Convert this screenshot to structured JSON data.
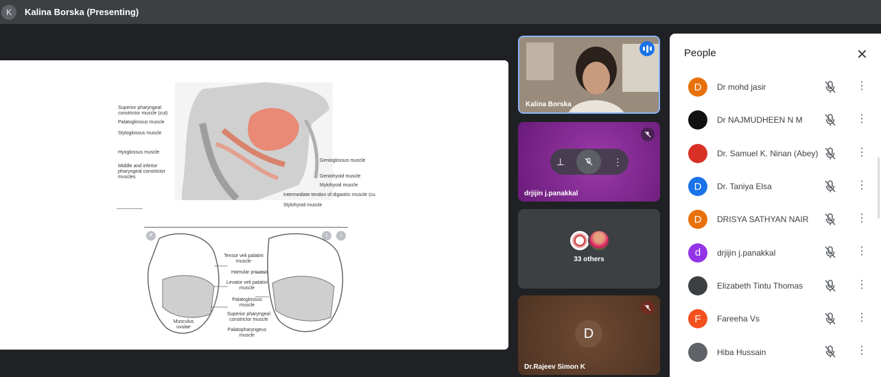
{
  "header": {
    "avatar_letter": "K",
    "title": "Kalina Borska (Presenting)"
  },
  "slide": {
    "top_labels_left": [
      "Superior pharyngeal constrictor muscle (cut)",
      "Palatoglossus muscle",
      "Styloglossus muscle",
      "Hyoglossus muscle",
      "Middle and inferior pharyngeal constrictor muscles"
    ],
    "top_labels_right": [
      "Genioglossus muscle",
      "Geniohyoid muscle",
      "Mylohyoid muscle",
      "Intermediate tendon of digastric muscle (cu",
      "Stylohyoid muscle"
    ],
    "bottom_labels": [
      "Tensor veli palatini muscle",
      "Hamular process",
      "Levator veli palatini muscle",
      "Palatoglossus muscle",
      "Superior pharyngeal constrictor muscle",
      "Palatopharyngeus muscle"
    ],
    "bottom_left_label": "Musculus uvulae"
  },
  "tiles": [
    {
      "name": "Kalina Borska",
      "state": "speaking"
    },
    {
      "name": "drjijin j.panakkal",
      "state": "muted"
    },
    {
      "name": "",
      "others_label": "33 others"
    },
    {
      "name": "Dr.Rajeev Simon K",
      "letter": "D",
      "state": "muted"
    }
  ],
  "people_panel": {
    "title": "People",
    "participants": [
      {
        "name": "Dr mohd jasir",
        "avatar": "D",
        "color": "#e8710a"
      },
      {
        "name": "Dr NAJMUDHEEN N M",
        "avatar": "",
        "color": "#111111"
      },
      {
        "name": "Dr. Samuel K. Ninan (Abey)",
        "avatar": "",
        "color": "#d93025"
      },
      {
        "name": "Dr. Taniya Elsa",
        "avatar": "D",
        "color": "#1a73e8"
      },
      {
        "name": "DRISYA SATHYAN NAIR",
        "avatar": "D",
        "color": "#e8710a"
      },
      {
        "name": "drjijin j.panakkal",
        "avatar": "d",
        "color": "#9334e6"
      },
      {
        "name": "Elizabeth Tintu Thomas",
        "avatar": "",
        "color": "#3c4043"
      },
      {
        "name": "Fareeha Vs",
        "avatar": "F",
        "color": "#f4511e"
      },
      {
        "name": "Hiba Hussain",
        "avatar": "",
        "color": "#5f6368"
      }
    ]
  }
}
